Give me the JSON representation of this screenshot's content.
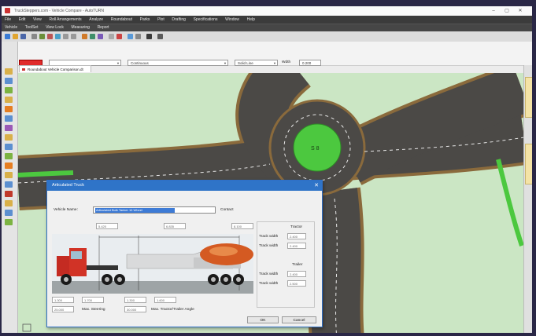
{
  "window": {
    "title": "TruckSteppers.com - Vehicle Compare - AutoTURN",
    "minimize": "–",
    "maximize": "▢",
    "close": "✕"
  },
  "menu_primary": [
    "File",
    "Edit",
    "View",
    "Roll Arrangements",
    "Analyze",
    "Roundabout",
    "Parks",
    "Plot",
    "Drafting",
    "Specifications",
    "Window",
    "Help"
  ],
  "menu_secondary": [
    "Vehicle",
    "ToolSet",
    "View Lock",
    "Measuring",
    "Report"
  ],
  "propbar": {
    "style_value": "",
    "layer_value": "",
    "linetype_value": "Continuous",
    "lineweight_value": "Solid Line",
    "width_label": "Wdth",
    "width_value": "0.200"
  },
  "doc_tab": "Roundabout Vehicle Comparison.dt",
  "roundabout_label": "S 8",
  "dialog": {
    "title": "Articulated Truck",
    "close": "✕",
    "vehicle_name_label": "Vehicle Name:",
    "vehicle_name_value": "Articulated Bulk Tanker 10 Wheel",
    "contact_button": "Contact",
    "top_dims": [
      "5.420",
      "6.835",
      "8.100"
    ],
    "bottom_dims": [
      "1.300",
      "1.700",
      "1.300",
      "1.600"
    ],
    "steering_value": "25.000",
    "steering_label": "Max. Steering",
    "angle_value": "30.000",
    "angle_label": "Max. Tractor/Trailer Angle",
    "tractor_heading": "Tractor",
    "trailer_heading": "Trailer",
    "tractor_rows": [
      {
        "label": "Track width",
        "value": "2.400"
      },
      {
        "label": "Track width",
        "value": "2.400"
      }
    ],
    "trailer_rows": [
      {
        "label": "Track width",
        "value": "2.400"
      },
      {
        "label": "Track width",
        "value": "2.500"
      }
    ],
    "ok_button": "OK",
    "cancel_button": "Cancel"
  },
  "colors": {
    "grass": "#cbe6c4",
    "asphalt": "#4b4946",
    "curb": "#8a6a3c",
    "island": "#4cc83f",
    "dialog_title": "#2f74c8",
    "red_swatch": "#e02b2b"
  }
}
